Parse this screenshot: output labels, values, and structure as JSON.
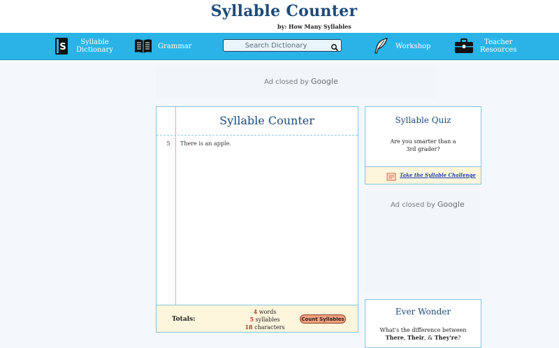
{
  "header": {
    "title": "Syllable Counter",
    "byline": "by: How Many Syllables"
  },
  "nav": {
    "dictionary_label_1": "Syllable",
    "dictionary_label_2": "Dictionary",
    "grammar_label": "Grammar",
    "search_placeholder": "Search Dictionary",
    "workshop_label": "Workshop",
    "teacher_label_1": "Teacher",
    "teacher_label_2": "Resources"
  },
  "ads": {
    "top_text": "Ad closed by",
    "side_text": "Ad closed by",
    "brand": "Google"
  },
  "counter": {
    "title": "Syllable Counter",
    "lines": [
      {
        "syllables": "5",
        "text": "There is an apple."
      }
    ],
    "totals_label": "Totals:",
    "words_count": "4",
    "words_label": "words",
    "syllables_count": "5",
    "syllables_label": "syllables",
    "characters_count": "18",
    "characters_label": "characters",
    "button_label": "Count Syllables"
  },
  "quiz": {
    "title": "Syllable Quiz",
    "question_1": "Are you smarter than a",
    "question_2": "3rd grader?",
    "link_label": "Take the Syllable Challenge"
  },
  "wonder": {
    "title": "Ever Wonder",
    "text_1": "What's the difference between",
    "word_1": "There",
    "word_2": "Their",
    "word_3": "They're"
  },
  "colors": {
    "nav_bg": "#2ab3e7",
    "title_blue": "#1c4a78",
    "panel_border": "#7fc6e3",
    "totals_bg": "#fdf5dc",
    "button_bg": "#f3a07e",
    "count_red": "#c0392b"
  }
}
